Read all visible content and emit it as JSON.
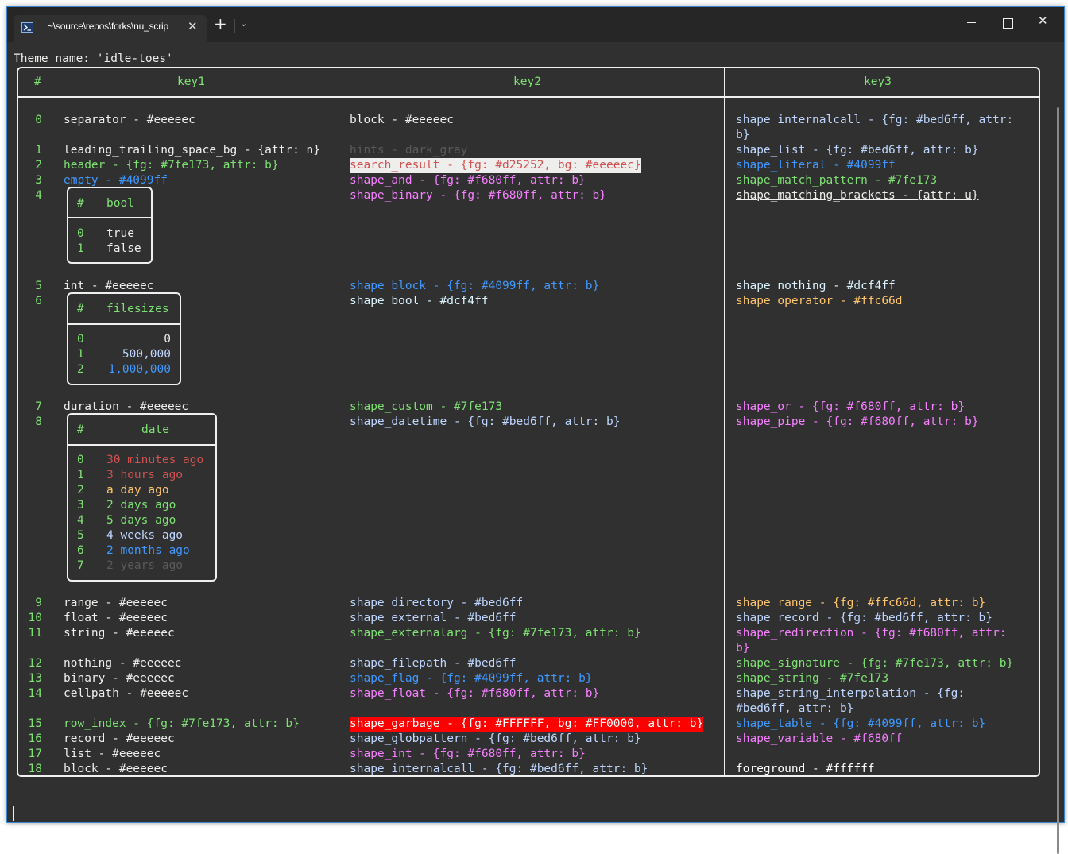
{
  "window": {
    "tab_title": "~\\source\\repos\\forks\\nu_scrip",
    "tab_icon": "powershell-icon",
    "close_tab_glyph": "✕",
    "new_tab_glyph": "+",
    "dropdown_glyph": "⌄",
    "minimize_glyph": "—",
    "maximize_glyph": "☐",
    "close_glyph": "✕"
  },
  "terminal": {
    "theme_line": "Theme name: 'idle-toes'",
    "headers": {
      "index": "#",
      "key1": "key1",
      "key2": "key2",
      "key3": "key3"
    },
    "row_numbers": [
      "0",
      "1",
      "2",
      "3",
      "4",
      "5",
      "6",
      "7",
      "8",
      "9",
      "10",
      "11",
      "12",
      "13",
      "14",
      "15",
      "16",
      "17",
      "18"
    ],
    "key1": {
      "separator": "separator - #eeeeec",
      "leading": "leading_trailing_space_bg - {attr: n}",
      "header": "header - {fg: #7fe173, attr: b}",
      "empty": "empty - #4099ff",
      "bool_table": {
        "header_index": "#",
        "header": "bool",
        "rows": [
          [
            "0",
            "true"
          ],
          [
            "1",
            "false"
          ]
        ]
      },
      "int": "int - #eeeeec",
      "filesizes_table": {
        "header_index": "#",
        "header": "filesizes",
        "rows": [
          [
            "0",
            "0"
          ],
          [
            "1",
            "500,000"
          ],
          [
            "2",
            "1,000,000"
          ]
        ]
      },
      "duration": "duration - #eeeeec",
      "date_table": {
        "header_index": "#",
        "header": "date",
        "rows": [
          [
            "0",
            "30 minutes ago"
          ],
          [
            "1",
            "3 hours ago"
          ],
          [
            "2",
            "a day ago"
          ],
          [
            "3",
            "2 days ago"
          ],
          [
            "4",
            "5 days ago"
          ],
          [
            "5",
            "4 weeks ago"
          ],
          [
            "6",
            "2 months ago"
          ],
          [
            "7",
            "2 years ago"
          ]
        ]
      },
      "range": "range - #eeeeec",
      "float": "float - #eeeeec",
      "string": "string - #eeeeec",
      "nothing": "nothing - #eeeeec",
      "binary": "binary - #eeeeec",
      "cellpath": "cellpath - #eeeeec",
      "row_index": "row_index - {fg: #7fe173, attr: b}",
      "record": "record - #eeeeec",
      "list": "list - #eeeeec",
      "block": "block - #eeeeec"
    },
    "key2": {
      "block": "block - #eeeeec",
      "hints": "hints - dark_gray",
      "search_result": "search_result - {fg: #d25252, bg: #eeeeec}",
      "shape_and": "shape_and - {fg: #f680ff, attr: b}",
      "shape_binary": "shape_binary - {fg: #f680ff, attr: b}",
      "shape_block": "shape_block - {fg: #4099ff, attr: b}",
      "shape_bool": "shape_bool - #dcf4ff",
      "shape_custom": "shape_custom - #7fe173",
      "shape_datetime": "shape_datetime - {fg: #bed6ff, attr: b}",
      "shape_directory": "shape_directory - #bed6ff",
      "shape_external": "shape_external - #bed6ff",
      "shape_externalarg": "shape_externalarg - {fg: #7fe173, attr: b}",
      "shape_filepath": "shape_filepath - #bed6ff",
      "shape_flag": "shape_flag - {fg: #4099ff, attr: b}",
      "shape_float": "shape_float - {fg: #f680ff, attr: b}",
      "shape_garbage": "shape_garbage - {fg: #FFFFFF, bg: #FF0000, attr: b}",
      "shape_globpattern": "shape_globpattern - {fg: #bed6ff, attr: b}",
      "shape_int": "shape_int - {fg: #f680ff, attr: b}",
      "shape_internalcall": "shape_internalcall - {fg: #bed6ff, attr: b}"
    },
    "key3": {
      "shape_internalcall_1": "shape_internalcall - {fg: #bed6ff, attr:",
      "shape_internalcall_2": "b}",
      "shape_list": "shape_list - {fg: #bed6ff, attr: b}",
      "shape_literal": "shape_literal - #4099ff",
      "shape_match_pattern": "shape_match_pattern - #7fe173",
      "shape_matching_brackets": "shape_matching_brackets - {attr: u}",
      "shape_nothing": "shape_nothing - #dcf4ff",
      "shape_operator": "shape_operator - #ffc66d",
      "shape_or": "shape_or - {fg: #f680ff, attr: b}",
      "shape_pipe": "shape_pipe - {fg: #f680ff, attr: b}",
      "shape_range": "shape_range - {fg: #ffc66d, attr: b}",
      "shape_record": "shape_record - {fg: #bed6ff, attr: b}",
      "shape_redirection_1": "shape_redirection - {fg: #f680ff, attr:",
      "shape_redirection_2": "b}",
      "shape_signature": "shape_signature - {fg: #7fe173, attr: b}",
      "shape_string": "shape_string - #7fe173",
      "shape_string_interpolation_1": "shape_string_interpolation - {fg:",
      "shape_string_interpolation_2": "#bed6ff, attr: b}",
      "shape_table": "shape_table - {fg: #4099ff, attr: b}",
      "shape_variable": "shape_variable - #f680ff",
      "foreground": "foreground - #ffffff"
    }
  }
}
